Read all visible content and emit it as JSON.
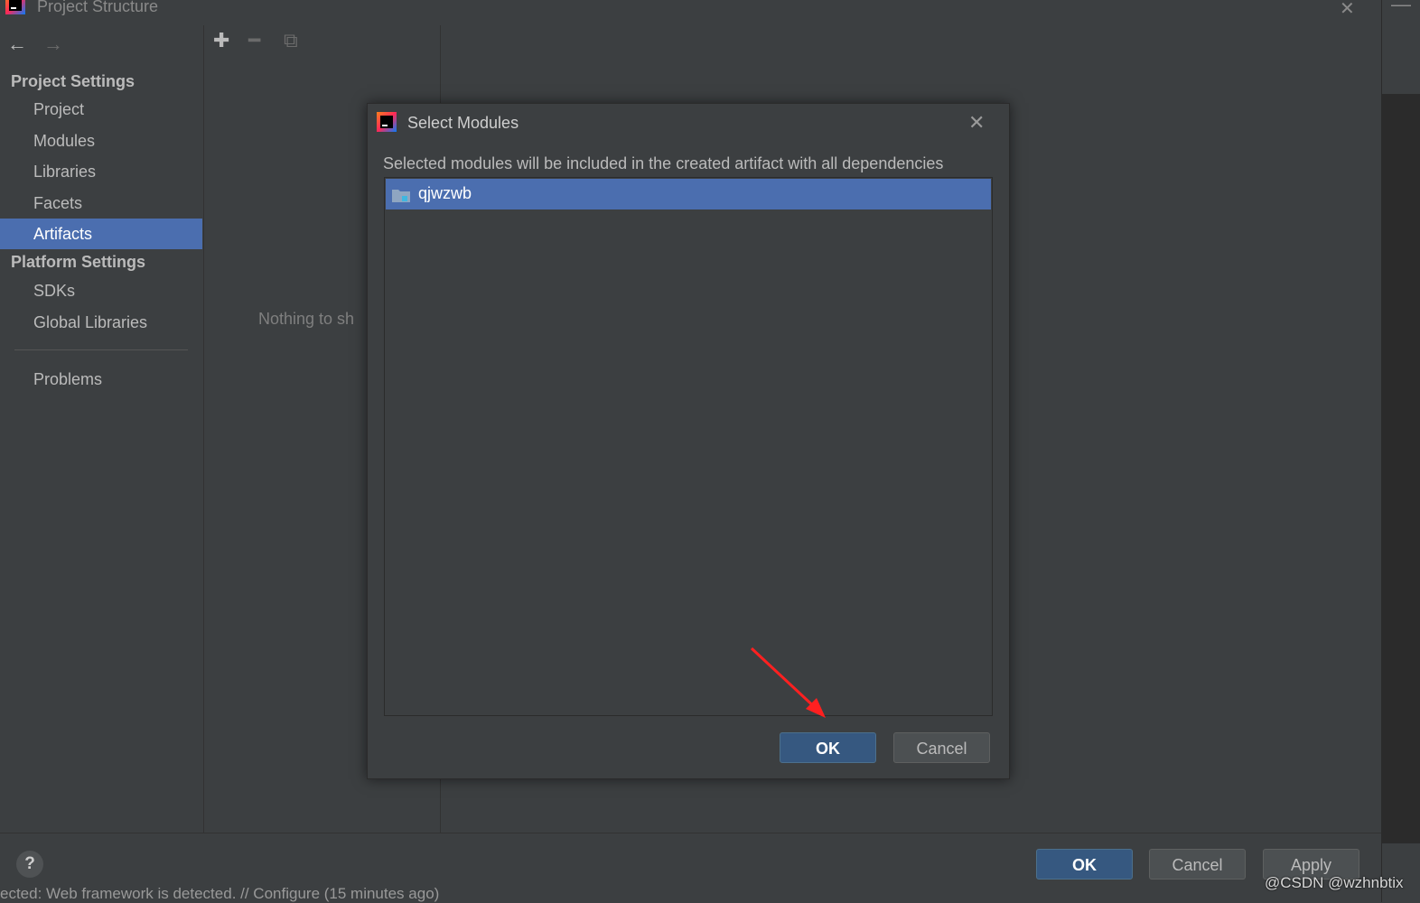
{
  "window": {
    "title": "Project Structure"
  },
  "sidebar": {
    "project_settings_header": "Project Settings",
    "project_items": [
      "Project",
      "Modules",
      "Libraries",
      "Facets",
      "Artifacts"
    ],
    "selected": "Artifacts",
    "platform_settings_header": "Platform Settings",
    "platform_items": [
      "SDKs",
      "Global Libraries"
    ],
    "problems": "Problems"
  },
  "content": {
    "empty_text": "Nothing to sh"
  },
  "dialog": {
    "title": "Select Modules",
    "description": "Selected modules will be included in the created artifact with all dependencies",
    "modules": [
      "qjwzwb"
    ],
    "ok_label": "OK",
    "cancel_label": "Cancel"
  },
  "footer": {
    "help_label": "?",
    "ok_label": "OK",
    "cancel_label": "Cancel",
    "apply_label": "Apply",
    "status_text": "ected: Web framework is detected. // Configure (15 minutes ago)"
  },
  "watermark": "@CSDN @wzhnbtix",
  "colors": {
    "selection": "#4b6eaf",
    "primary_button": "#365880",
    "background": "#3c3f41",
    "annotation_arrow": "#ff2020"
  },
  "icons": {
    "back": "arrow-left-icon",
    "forward": "arrow-right-icon",
    "add": "plus-icon",
    "remove": "minus-icon",
    "copy": "copy-icon",
    "module": "folder-icon"
  }
}
